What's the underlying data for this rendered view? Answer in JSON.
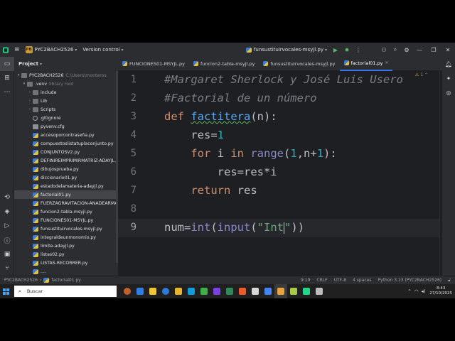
{
  "titlebar": {
    "project_badge": "PB",
    "project_name": "PYC2BACH2526",
    "vcs": "Version control",
    "run_config": "funsustituirvocales-msyjl.py"
  },
  "project_panel": {
    "header": "Project",
    "root": {
      "name": "PYC2BACH2526",
      "path": "C:\\Users\\monteros"
    },
    "venv": {
      "name": ".venv",
      "note": "library root"
    },
    "venv_children": [
      "include",
      "Lib",
      "Scripts",
      ".gitignore",
      "pyvenv.cfg"
    ],
    "files": [
      "accesoporcontraseña.py",
      "compuestoslistatuplaconjunto.py",
      "CONJUNTOSV2.py",
      "DEFINIREIMPRIMIRMATRIZ-ADAYJL.py",
      "dibujosprueba.py",
      "diccionario01.py",
      "estadodelamateria-adayjl.py",
      "factorial01.py",
      "FUERZAGRAVITACION-ANADEARMAS.py",
      "funcion2-tabla-msyjl.py",
      "FUNCIONES01-MSYJL.py",
      "funsustituirvocales-msyjl.py",
      "integraldeunmonomio.py",
      "limite-adayjl.py",
      "listas02.py",
      "LISTAS-RECORRER.py",
      "...."
    ],
    "selected": "factorial01.py"
  },
  "tabs": [
    {
      "label": "FUNCIONES01-MSYJL.py",
      "active": false
    },
    {
      "label": "funcion2-tabla-msyjl.py",
      "active": false
    },
    {
      "label": "funsustituirvocales-msyjl.py",
      "active": false
    },
    {
      "label": "factorial01.py",
      "active": true
    }
  ],
  "editor": {
    "line_numbers": [
      "1",
      "2",
      "3",
      "4",
      "5",
      "6",
      "7",
      "8",
      "9"
    ],
    "current_line": 9,
    "inspection": "1",
    "lines": [
      {
        "segments": [
          {
            "cls": "cmt",
            "text": "#Margaret Sherlock y José Luis Usero"
          }
        ]
      },
      {
        "segments": [
          {
            "cls": "cmt",
            "text": "#Factorial de un número"
          }
        ]
      },
      {
        "segments": [
          {
            "cls": "kw",
            "text": "def "
          },
          {
            "cls": "fn",
            "text": "factitera"
          },
          {
            "cls": "",
            "text": "(n):"
          }
        ]
      },
      {
        "segments": [
          {
            "cls": "",
            "text": "    res="
          },
          {
            "cls": "num",
            "text": "1"
          }
        ]
      },
      {
        "segments": [
          {
            "cls": "",
            "text": "    "
          },
          {
            "cls": "kw",
            "text": "for "
          },
          {
            "cls": "",
            "text": "i "
          },
          {
            "cls": "kw",
            "text": "in "
          },
          {
            "cls": "builtin",
            "text": "range"
          },
          {
            "cls": "",
            "text": "("
          },
          {
            "cls": "num",
            "text": "1"
          },
          {
            "cls": "",
            "text": ",n+"
          },
          {
            "cls": "num",
            "text": "1"
          },
          {
            "cls": "",
            "text": "):"
          }
        ]
      },
      {
        "segments": [
          {
            "cls": "",
            "text": "        res=res*i"
          }
        ]
      },
      {
        "segments": [
          {
            "cls": "",
            "text": "    "
          },
          {
            "cls": "kw",
            "text": "return "
          },
          {
            "cls": "",
            "text": "res"
          }
        ]
      },
      {
        "segments": []
      },
      {
        "segments": [
          {
            "cls": "",
            "text": "num="
          },
          {
            "cls": "builtin",
            "text": "int"
          },
          {
            "cls": "",
            "text": "("
          },
          {
            "cls": "builtin",
            "text": "input"
          },
          {
            "cls": "",
            "text": "("
          },
          {
            "cls": "str",
            "text": "\"Int"
          },
          {
            "cls": "caret",
            "text": ""
          },
          {
            "cls": "str",
            "text": "\""
          },
          {
            "cls": "",
            "text": "))"
          }
        ]
      }
    ]
  },
  "statusbar": {
    "project": "PYC2BACH2526",
    "file": "factorial01.py",
    "position": "9:19",
    "line_sep": "CRLF",
    "encoding": "UTF-8",
    "indent": "4 spaces",
    "interpreter": "Python 3.13 (PYC2BACH2526)"
  },
  "taskbar": {
    "search_placeholder": "Buscar",
    "time": "8:43",
    "date": "27/10/2025",
    "app_colors": [
      "#c1602b",
      "#2f7ee6",
      "#f2c431",
      "#2b7bd8",
      "#e6b52e",
      "#0d9ddb",
      "#3db04a",
      "#7b3fe4",
      "#2e8b57",
      "#f05a28",
      "#d7d7d7",
      "#4285f4",
      "#e8a33c",
      "#a7c94a",
      "#21d789",
      "#bdbdbd"
    ]
  },
  "colors": {
    "accent": "#3574f0",
    "background": "#1e1f22",
    "panel": "#2b2d30"
  }
}
